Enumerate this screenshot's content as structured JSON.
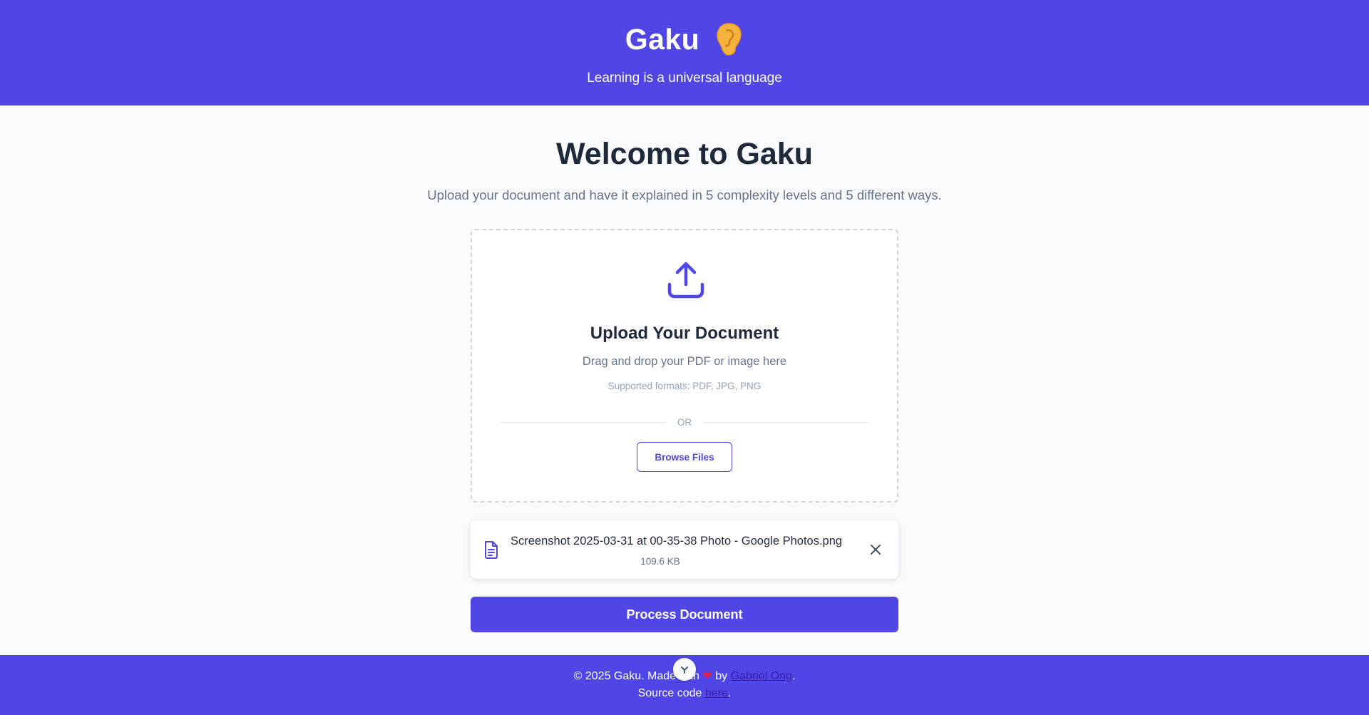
{
  "header": {
    "title": "Gaku",
    "tagline": "Learning is a universal language",
    "background": "#4f46e5"
  },
  "main": {
    "welcome": "Welcome to Gaku",
    "subtitle": "Upload your document and have it explained in 5 complexity levels and 5 different ways."
  },
  "dropzone": {
    "icon": "upload-icon",
    "title": "Upload Your Document",
    "text": "Drag and drop your PDF or image here",
    "formats": "Supported formats: PDF, JPG, PNG",
    "divider": "OR",
    "browse_label": "Browse Files"
  },
  "file": {
    "icon": "document-icon",
    "name": "Screenshot 2025-03-31 at 00-35-38 Photo - Google Photos.png",
    "size": "109.6 KB",
    "remove_icon": "close-icon"
  },
  "actions": {
    "process_label": "Process Document"
  },
  "footer": {
    "copyright_prefix": "© 2025 Gaku. Made with",
    "by": "by",
    "author": "Gabriel Ong",
    "source_prefix": "Source code",
    "source_link": "here",
    "accent": "#4f46e5"
  }
}
